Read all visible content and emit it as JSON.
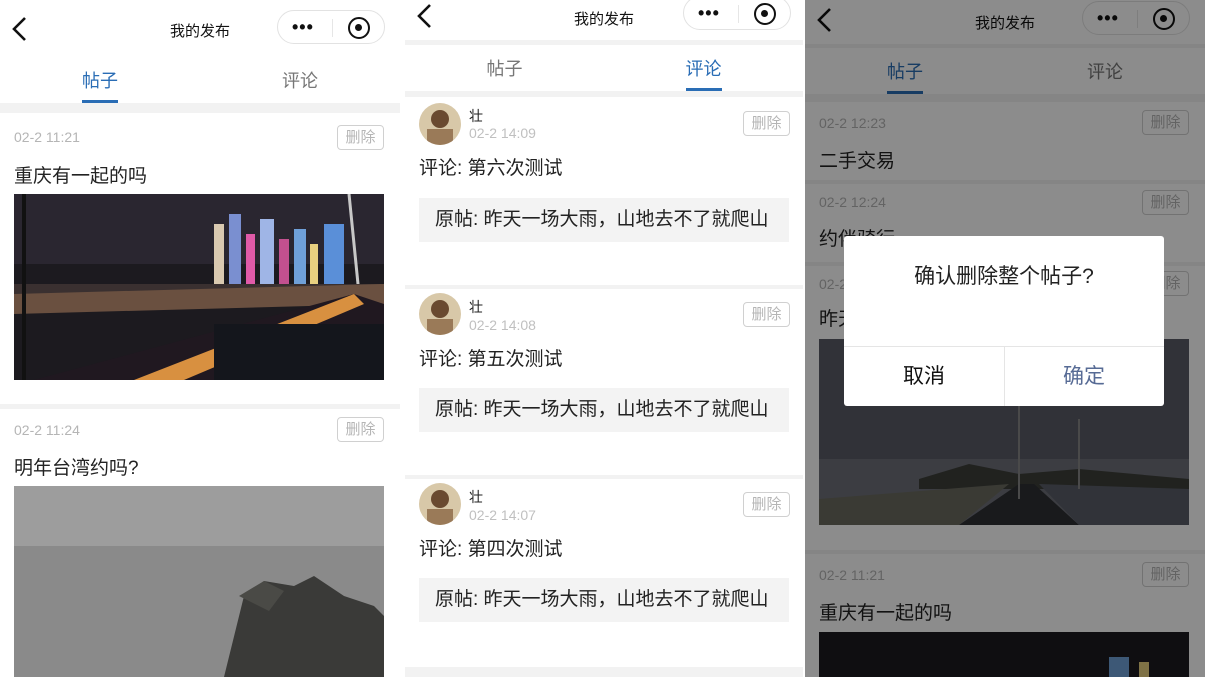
{
  "colors": {
    "accent": "#2a6db5",
    "time": "#b5b5b5",
    "confirm": "#576b95"
  },
  "nav": {
    "title": "我的发布",
    "dots": "•••"
  },
  "tabs": {
    "posts": "帖子",
    "comments": "评论"
  },
  "delete_label": "删除",
  "panel1": {
    "posts": [
      {
        "time": "02-2 11:21",
        "text": "重庆有一起的吗",
        "image": "night-bridge-city-photo"
      },
      {
        "time": "02-2 11:24",
        "text": "明年台湾约吗?",
        "image": "sea-rock-photo"
      }
    ]
  },
  "panel2": {
    "comments": [
      {
        "name": "壮",
        "time": "02-2 14:09",
        "comment": "评论: 第六次测试",
        "original": "原帖: 昨天一场大雨，山地去不了就爬山"
      },
      {
        "name": "壮",
        "time": "02-2 14:08",
        "comment": "评论: 第五次测试",
        "original": "原帖: 昨天一场大雨，山地去不了就爬山"
      },
      {
        "name": "壮",
        "time": "02-2 14:07",
        "comment": "评论: 第四次测试",
        "original": "原帖: 昨天一场大雨，山地去不了就爬山"
      }
    ]
  },
  "panel3": {
    "posts": [
      {
        "time": "02-2 12:23",
        "text": "二手交易"
      },
      {
        "time": "02-2 12:24",
        "text": "约伴骑行"
      },
      {
        "time": "02-2 12:25",
        "text": "昨天一场大雨"
      },
      {
        "time": "02-2 11:21",
        "text": "重庆有一起的吗"
      }
    ],
    "dialog": {
      "title": "确认删除整个帖子?",
      "cancel": "取消",
      "confirm": "确定"
    }
  }
}
